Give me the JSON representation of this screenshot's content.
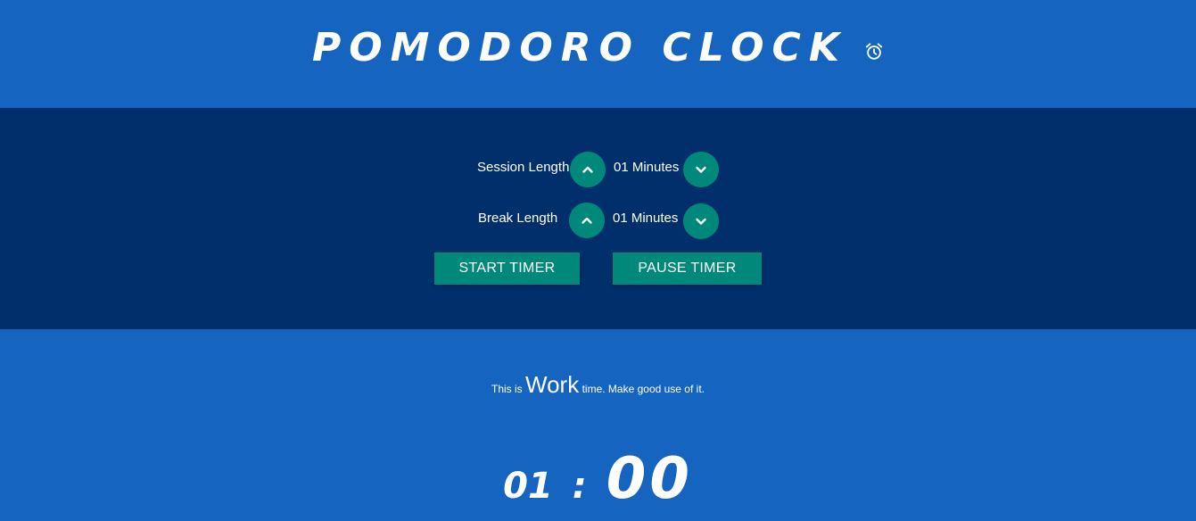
{
  "header": {
    "title": "POMODORO CLOCK",
    "icon": "alarm-clock-icon"
  },
  "controls": {
    "session": {
      "label": "Session Length",
      "value": "01 Minutes",
      "increase_icon": "chevron-up-icon",
      "decrease_icon": "chevron-down-icon"
    },
    "break": {
      "label": "Break Length",
      "value": "01 Minutes",
      "increase_icon": "chevron-up-icon",
      "decrease_icon": "chevron-down-icon"
    },
    "start_label": "START TIMER",
    "pause_label": "PAUSE TIMER"
  },
  "status": {
    "prefix": "This is",
    "mode": "Work",
    "suffix": "time. Make good use of it."
  },
  "timer": {
    "minutes": "01",
    "separator": ":",
    "seconds": "00"
  },
  "colors": {
    "background": "#1565c0",
    "panel": "#002f6c",
    "accent": "#00897b",
    "text": "#ffffff"
  }
}
